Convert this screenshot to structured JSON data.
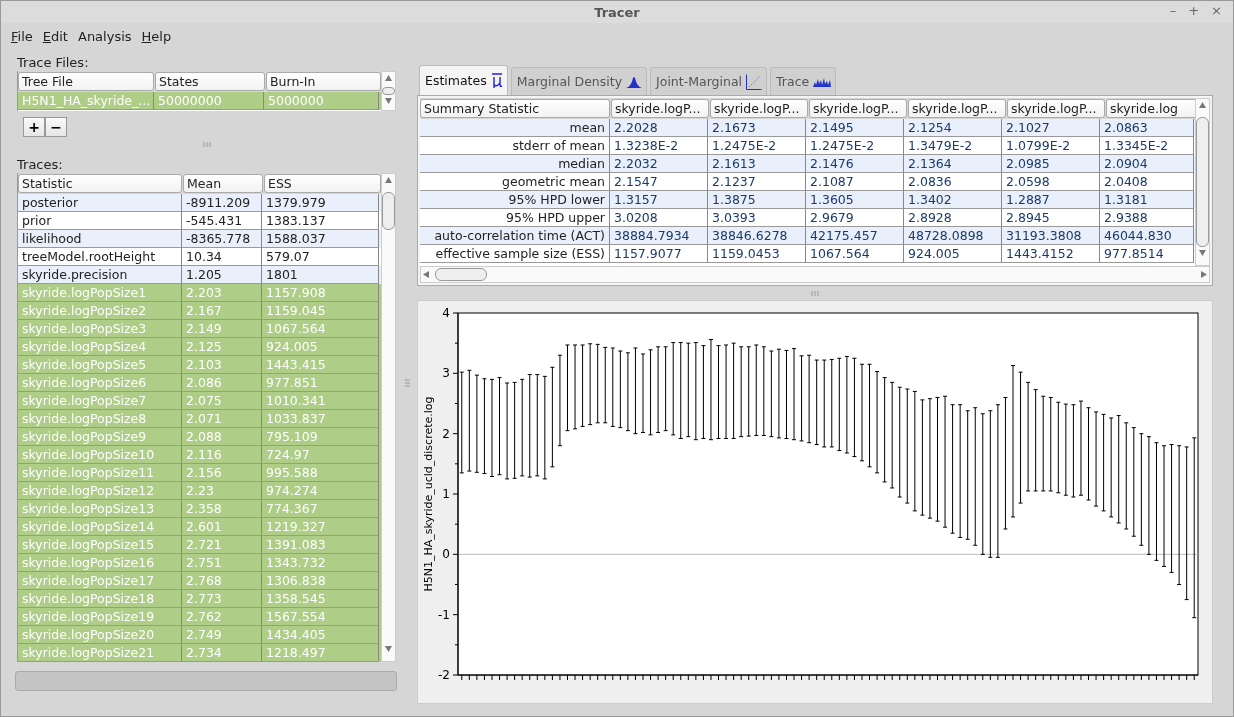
{
  "window": {
    "title": "Tracer",
    "controls": [
      "–",
      "+",
      "×"
    ]
  },
  "menu": [
    {
      "label": "File",
      "mnemonic": true
    },
    {
      "label": "Edit",
      "mnemonic": true
    },
    {
      "label": "Analysis",
      "mnemonic": false
    },
    {
      "label": "Help",
      "mnemonic": true
    }
  ],
  "trace_files": {
    "label": "Trace Files:",
    "columns": [
      "Tree File",
      "States",
      "Burn-In"
    ],
    "rows": [
      {
        "cells": [
          "H5N1_HA_skyride_...",
          "50000000",
          "5000000"
        ],
        "selected": true
      }
    ],
    "buttons": [
      "+",
      "−"
    ]
  },
  "traces": {
    "label": "Traces:",
    "columns": [
      "Statistic",
      "Mean",
      "ESS"
    ],
    "rows": [
      {
        "cells": [
          "posterior",
          "-8911.209",
          "1379.979"
        ],
        "selected": false
      },
      {
        "cells": [
          "prior",
          "-545.431",
          "1383.137"
        ],
        "selected": false
      },
      {
        "cells": [
          "likelihood",
          "-8365.778",
          "1588.037"
        ],
        "selected": false
      },
      {
        "cells": [
          "treeModel.rootHeight",
          "10.34",
          "579.07"
        ],
        "selected": false
      },
      {
        "cells": [
          "skyride.precision",
          "1.205",
          "1801"
        ],
        "selected": false
      },
      {
        "cells": [
          "skyride.logPopSize1",
          "2.203",
          "1157.908"
        ],
        "selected": true
      },
      {
        "cells": [
          "skyride.logPopSize2",
          "2.167",
          "1159.045"
        ],
        "selected": true
      },
      {
        "cells": [
          "skyride.logPopSize3",
          "2.149",
          "1067.564"
        ],
        "selected": true
      },
      {
        "cells": [
          "skyride.logPopSize4",
          "2.125",
          "924.005"
        ],
        "selected": true
      },
      {
        "cells": [
          "skyride.logPopSize5",
          "2.103",
          "1443.415"
        ],
        "selected": true
      },
      {
        "cells": [
          "skyride.logPopSize6",
          "2.086",
          "977.851"
        ],
        "selected": true
      },
      {
        "cells": [
          "skyride.logPopSize7",
          "2.075",
          "1010.341"
        ],
        "selected": true
      },
      {
        "cells": [
          "skyride.logPopSize8",
          "2.071",
          "1033.837"
        ],
        "selected": true
      },
      {
        "cells": [
          "skyride.logPopSize9",
          "2.088",
          "795.109"
        ],
        "selected": true
      },
      {
        "cells": [
          "skyride.logPopSize10",
          "2.116",
          "724.97"
        ],
        "selected": true
      },
      {
        "cells": [
          "skyride.logPopSize11",
          "2.156",
          "995.588"
        ],
        "selected": true
      },
      {
        "cells": [
          "skyride.logPopSize12",
          "2.23",
          "974.274"
        ],
        "selected": true
      },
      {
        "cells": [
          "skyride.logPopSize13",
          "2.358",
          "774.367"
        ],
        "selected": true
      },
      {
        "cells": [
          "skyride.logPopSize14",
          "2.601",
          "1219.327"
        ],
        "selected": true
      },
      {
        "cells": [
          "skyride.logPopSize15",
          "2.721",
          "1391.083"
        ],
        "selected": true
      },
      {
        "cells": [
          "skyride.logPopSize16",
          "2.751",
          "1343.732"
        ],
        "selected": true
      },
      {
        "cells": [
          "skyride.logPopSize17",
          "2.768",
          "1306.838"
        ],
        "selected": true
      },
      {
        "cells": [
          "skyride.logPopSize18",
          "2.773",
          "1358.545"
        ],
        "selected": true
      },
      {
        "cells": [
          "skyride.logPopSize19",
          "2.762",
          "1567.554"
        ],
        "selected": true
      },
      {
        "cells": [
          "skyride.logPopSize20",
          "2.749",
          "1434.405"
        ],
        "selected": true
      },
      {
        "cells": [
          "skyride.logPopSize21",
          "2.734",
          "1218.497"
        ],
        "selected": true
      }
    ]
  },
  "tabs": [
    {
      "label": "Estimates",
      "kind": "estimates",
      "selected": true
    },
    {
      "label": "Marginal Density",
      "kind": "density",
      "selected": false
    },
    {
      "label": "Joint-Marginal",
      "kind": "joint",
      "selected": false
    },
    {
      "label": "Trace",
      "kind": "trace",
      "selected": false
    }
  ],
  "estimates": {
    "columns": [
      "Summary Statistic",
      "skyride.logP...",
      "skyride.logP...",
      "skyride.logP...",
      "skyride.logP...",
      "skyride.logP...",
      "skyride.log"
    ],
    "rows": [
      {
        "cells": [
          "mean",
          "2.2028",
          "2.1673",
          "2.1495",
          "2.1254",
          "2.1027",
          "2.0863"
        ]
      },
      {
        "cells": [
          "stderr of mean",
          "1.3238E-2",
          "1.2475E-2",
          "1.2475E-2",
          "1.3479E-2",
          "1.0799E-2",
          "1.3345E-2"
        ]
      },
      {
        "cells": [
          "median",
          "2.2032",
          "2.1613",
          "2.1476",
          "2.1364",
          "2.0985",
          "2.0904"
        ]
      },
      {
        "cells": [
          "geometric mean",
          "2.1547",
          "2.1237",
          "2.1087",
          "2.0836",
          "2.0598",
          "2.0408"
        ]
      },
      {
        "cells": [
          "95% HPD lower",
          "1.3157",
          "1.3875",
          "1.3605",
          "1.3402",
          "1.2887",
          "1.3181"
        ]
      },
      {
        "cells": [
          "95% HPD upper",
          "3.0208",
          "3.0393",
          "2.9679",
          "2.8928",
          "2.8945",
          "2.9388"
        ]
      },
      {
        "cells": [
          "auto-correlation time (ACT)",
          "38884.7934",
          "38846.6278",
          "42175.457",
          "48728.0898",
          "31193.3808",
          "46044.830"
        ]
      },
      {
        "cells": [
          "effective sample size (ESS)",
          "1157.9077",
          "1159.0453",
          "1067.564",
          "924.005",
          "1443.4152",
          "977.8514"
        ]
      }
    ]
  },
  "chart": {
    "ylabel": "H5N1_HA_skyride_ucld_discrete.log",
    "yticks": [
      "4",
      "3",
      "2",
      "1",
      "0",
      "-1",
      "-2"
    ]
  }
}
